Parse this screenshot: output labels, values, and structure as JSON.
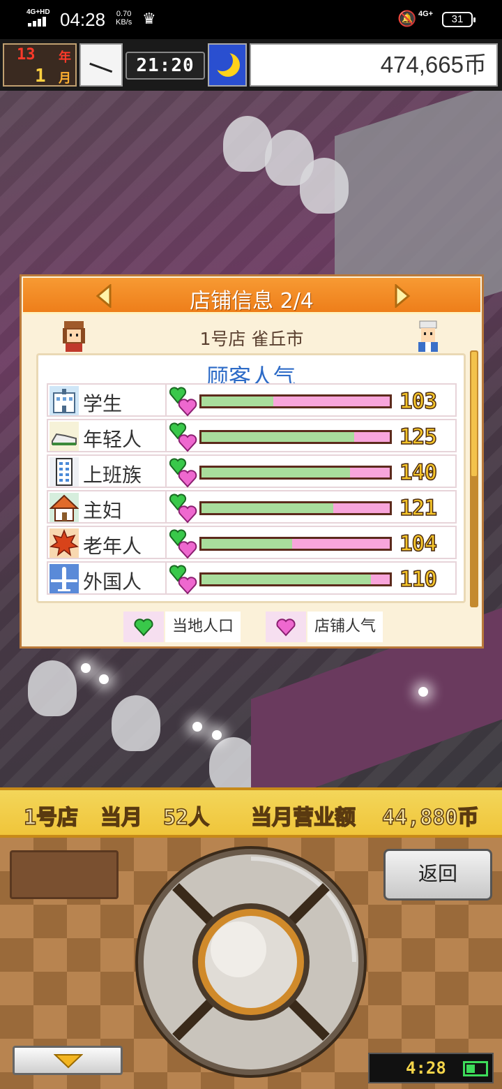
{
  "status_bar": {
    "network": "4G+HD",
    "time": "04:28",
    "speed_value": "0.70",
    "speed_unit": "KB/s",
    "network_right": "4G+",
    "battery": "31"
  },
  "hud": {
    "year": "13",
    "year_unit": "年",
    "month": "1",
    "month_unit": "月",
    "game_time": "21:20",
    "money": "474,665币"
  },
  "panel": {
    "title": "店铺信息 2/4",
    "store_name": "1号店 雀丘市",
    "section_title": "顾客人气",
    "rows": [
      {
        "label": "学生",
        "value": "103",
        "local_fraction": 0.38,
        "icon": "school-icon"
      },
      {
        "label": "年轻人",
        "value": "125",
        "local_fraction": 0.81,
        "icon": "shoe-icon"
      },
      {
        "label": "上班族",
        "value": "140",
        "local_fraction": 0.79,
        "icon": "office-building-icon"
      },
      {
        "label": "主妇",
        "value": "121",
        "local_fraction": 0.7,
        "icon": "house-icon"
      },
      {
        "label": "老年人",
        "value": "104",
        "local_fraction": 0.48,
        "icon": "maple-leaf-icon"
      },
      {
        "label": "外国人",
        "value": "110",
        "local_fraction": 0.9,
        "icon": "airplane-icon"
      }
    ],
    "legend_local": "当地人口",
    "legend_store": "店铺人气",
    "colors": {
      "local": "#a9dd9c",
      "store": "#f8a5db",
      "local_heart": "#39c84a",
      "store_heart": "#ee68cf"
    }
  },
  "ticker": {
    "store": "1号店",
    "month": "当月",
    "people": "52人",
    "sales_label": "当月营业额",
    "sales_amount": "44,880币"
  },
  "controls": {
    "back_label": "返回",
    "clock": "4:28"
  }
}
